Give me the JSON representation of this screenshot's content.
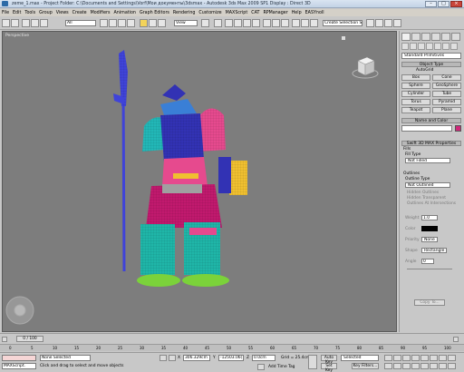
{
  "window": {
    "title": "zeme_1.max   -  Project Folder: C:\\Documents and Settings\\Vorf\\Мои документы\\3dsmax   -  Autodesk 3ds Max 2009 SP1          Display : Direct 3D"
  },
  "menu": [
    "File",
    "Edit",
    "Tools",
    "Group",
    "Views",
    "Create",
    "Modifiers",
    "Animation",
    "Graph Editors",
    "Rendering",
    "Customize",
    "MAXScript",
    "CAT",
    "RPManager",
    "Help",
    "EASYnoll"
  ],
  "toolbar": {
    "filter_select": "All",
    "view_select": "View",
    "selection_set": "Create Selection Set"
  },
  "viewport": {
    "label": "Perspective"
  },
  "command_panel": {
    "category_select": "Standard Primitives",
    "object_type_header": "Object Type",
    "autogrid_label": "AutoGrid",
    "object_buttons": [
      [
        "Box",
        "Cone"
      ],
      [
        "Sphere",
        "GeoSphere"
      ],
      [
        "Cylinder",
        "Tube"
      ],
      [
        "Torus",
        "Pyramid"
      ],
      [
        "Teapot",
        "Plane"
      ]
    ],
    "name_color_header": "Name and Color",
    "swift_header": "Swift 3D MAX Properties",
    "fills_label": "Fills",
    "fill_type_label": "Fill Type",
    "fill_type_value": "Not Filled",
    "outlines_label": "Outlines",
    "outline_type_label": "Outline Type",
    "outline_type_value": "Not Outlined",
    "hidden_outlines": "Hidden Outlines",
    "hidden_transparent": "Hidden Transparent",
    "outlines_intersections": "Outlines At Intersections",
    "weight_label": "Weight",
    "weight_value": "1.0",
    "color_label": "Color",
    "priority_label": "Priority",
    "priority_value": "None",
    "shape_label": "Shape",
    "shape_value": "Rectangle",
    "angle_label": "Angle",
    "angle_value": "0",
    "copy_to_label": "Copy To..."
  },
  "timeline": {
    "frame_counter": "0 / 100",
    "ticks": [
      "0",
      "5",
      "10",
      "15",
      "20",
      "25",
      "30",
      "35",
      "40",
      "45",
      "50",
      "55",
      "60",
      "65",
      "70",
      "75",
      "80",
      "85",
      "90",
      "95",
      "100"
    ]
  },
  "status": {
    "maxscript_label": "MAXScript.",
    "selection_status": "None Selected",
    "prompt": "Click and drag to select and move objects",
    "x_label": "X",
    "x_value": "306.329cm",
    "y_label": "Y",
    "y_value": "-12503.06(",
    "z_label": "Z",
    "z_value": "0.0cm",
    "grid": "Grid = 25.4cm",
    "add_time_tag": "Add Time Tag",
    "auto_key": "Auto Key",
    "set_key": "Set Key",
    "key_selected": "Selected",
    "key_filters": "Key Filters..."
  },
  "colors": {
    "viewport_bg": "#7d7d7d",
    "object_color_swatch": "#d0287a",
    "spear": "#3f43d9",
    "helmet": "#e64a8e",
    "chest": "#3232b4",
    "arm": "#f0c030",
    "legs": "#1fb6a8",
    "feet": "#7bd23a"
  }
}
